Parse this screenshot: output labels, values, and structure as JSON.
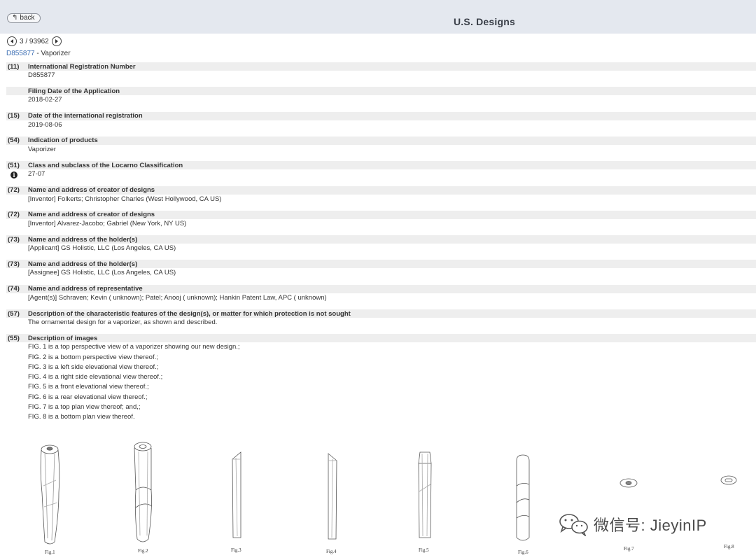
{
  "header": {
    "back_label": "back",
    "title": "U.S. Designs"
  },
  "pager": {
    "text": "3 / 93962"
  },
  "document": {
    "number": "D855877",
    "title_suffix": " - Vaporizer"
  },
  "fields": [
    {
      "code": "(11)",
      "label": "International Registration Number",
      "values": [
        "D855877"
      ]
    },
    {
      "code": "",
      "label": "Filing Date of the Application",
      "values": [
        "2018-02-27"
      ]
    },
    {
      "code": "(15)",
      "label": "Date of the international registration",
      "values": [
        "2019-08-06"
      ]
    },
    {
      "code": "(54)",
      "label": "Indication of products",
      "values": [
        "Vaporizer"
      ]
    },
    {
      "code": "(51)",
      "label": "Class and subclass of the Locarno Classification",
      "values": [
        "27-07"
      ],
      "info_icon": "info-icon"
    },
    {
      "code": "(72)",
      "label": "Name and address of creator of designs",
      "values": [
        "[Inventor] Folkerts; Christopher Charles (West Hollywood, CA US)"
      ]
    },
    {
      "code": "(72)",
      "label": "Name and address of creator of designs",
      "values": [
        "[Inventor] Alvarez-Jacobo; Gabriel (New York, NY US)"
      ]
    },
    {
      "code": "(73)",
      "label": "Name and address of the holder(s)",
      "values": [
        "[Applicant]  GS Holistic, LLC (Los Angeles, CA US)"
      ]
    },
    {
      "code": "(73)",
      "label": "Name and address of the holder(s)",
      "values": [
        "[Assignee]  GS Holistic, LLC (Los Angeles, CA US)"
      ]
    },
    {
      "code": "(74)",
      "label": "Name and address of representative",
      "values": [
        "[Agent(s)] Schraven; Kevin ( unknown); Patel; Anooj ( unknown); Hankin Patent Law, APC ( unknown)"
      ]
    },
    {
      "code": "(57)",
      "label": "Description of the characteristic features of the design(s), or matter for which protection is not sought",
      "values": [
        "The ornamental design for a vaporizer, as shown and described."
      ]
    },
    {
      "code": "(55)",
      "label": "Description of images",
      "values": [
        "FIG. 1 is a top perspective view of a vaporizer showing our new design.;",
        "FIG. 2 is a bottom perspective view thereof.;",
        "FIG. 3 is a left side elevational view thereof.;",
        "FIG. 4 is a right side elevational view thereof.;",
        "FIG. 5 is a front elevational view thereof.;",
        "FIG. 6 is a rear elevational view thereof.;",
        "FIG. 7 is a top plan view thereof; and,;",
        "FIG. 8 is a bottom plan view thereof."
      ]
    }
  ],
  "figures": [
    {
      "caption": "Fig.1"
    },
    {
      "caption": "Fig.2"
    },
    {
      "caption": "Fig.3"
    },
    {
      "caption": "Fig.4"
    },
    {
      "caption": "Fig.5"
    },
    {
      "caption": "Fig.6"
    },
    {
      "caption": "Fig.7"
    },
    {
      "caption": "Fig.8"
    }
  ],
  "watermark": {
    "text": "微信号: JieyinIP",
    "icon": "wechat-icon"
  },
  "icons": {
    "back": "back-arrow-icon",
    "prev": "chevron-left-icon",
    "next": "chevron-right-icon"
  }
}
